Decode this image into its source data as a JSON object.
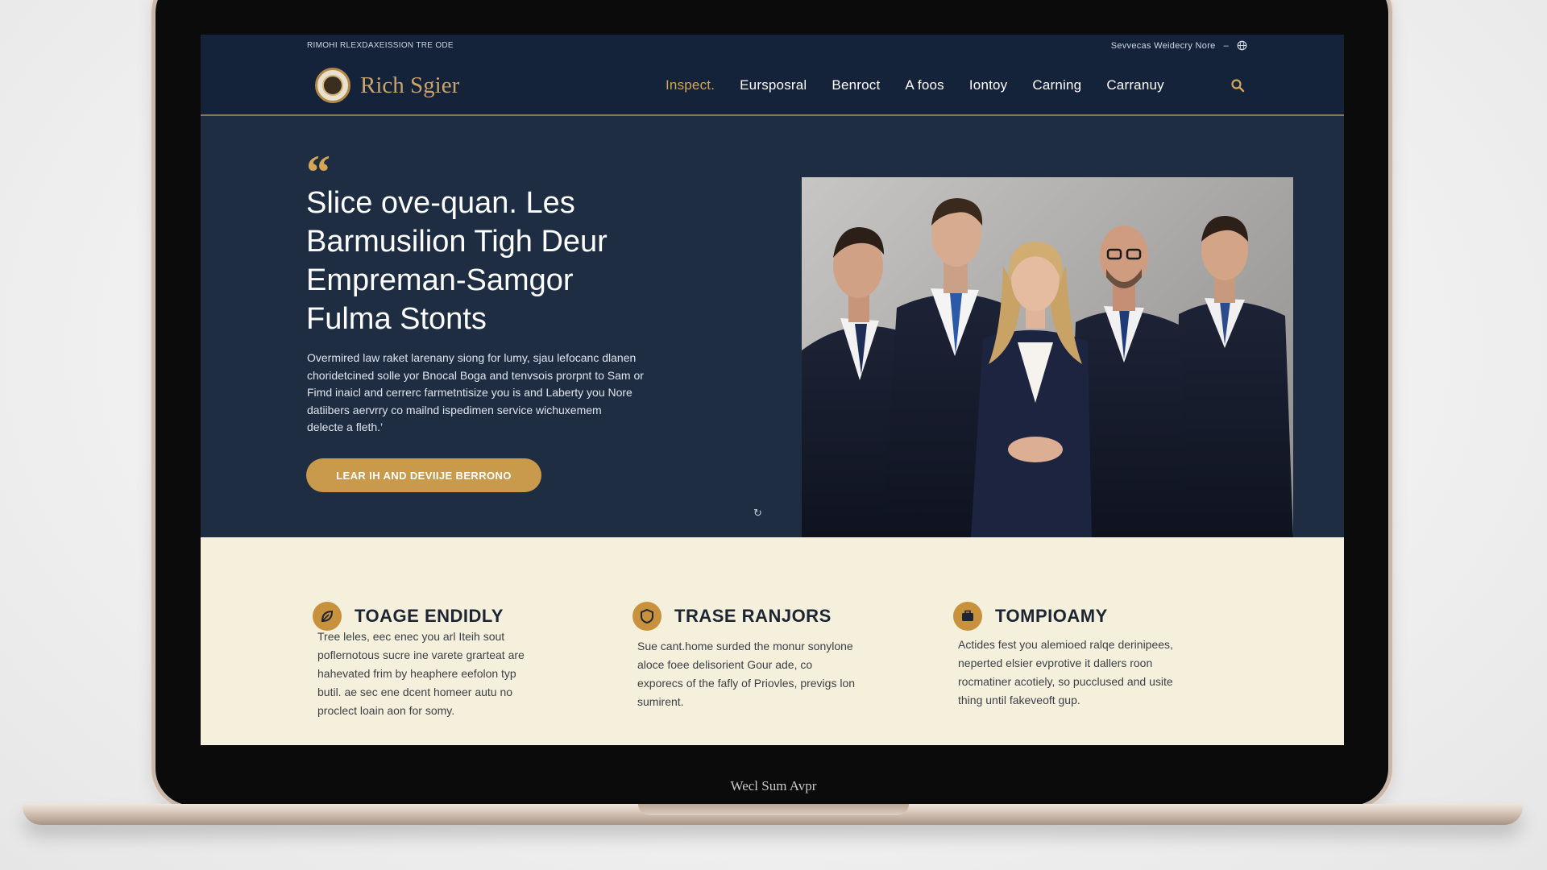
{
  "device": {
    "chin_label": "Wecl Sum Avpr"
  },
  "site": {
    "topbar": {
      "left_text": "RIMOHI RLEXDAXEISSION TRE ODE",
      "right_text": "Sevvecas Weidecry Nore"
    },
    "logo_text": "Rich Sgier",
    "nav": [
      {
        "label": "Inspect.",
        "active": true
      },
      {
        "label": "Eursposral"
      },
      {
        "label": "Benroct"
      },
      {
        "label": "A foos"
      },
      {
        "label": "Iontoy"
      },
      {
        "label": "Carning"
      },
      {
        "label": "Carranuy"
      }
    ],
    "accent_color": "#c99a4c",
    "navy_color": "#14223a"
  },
  "hero": {
    "quote_mark": "“",
    "title_lines": [
      "Slice ove-quan. Les",
      "Barmusilion Tigh Deur",
      "Empreman-Samgor",
      "Fulma Stonts"
    ],
    "body_lines": [
      "Overmired law raket larenany siong for lumy, sjau lefocanc dlanen",
      "choridetcined solle yor Bnocal Boga and tenvsois prorpnt to Sam or",
      "Fimd inaicl and cerrerc farmetntisize you is and Laberty you Nore",
      "datiibers aervrry co mailnd ispedimen service wichuxemem",
      "delecte a fleth.’"
    ],
    "cta_label": "LEAR IH AND DEVIIJE BERRONO",
    "carousel_indicator": "↻"
  },
  "features": [
    {
      "icon": "leaf-icon",
      "title": "TOAGE ENDIDLY",
      "body_lines": [
        "Tree leles, eec enec you arl Iteih sout",
        "poflernotous sucre ine varete grarteat are",
        "hahevated frim by heaphere eefolon typ",
        "butil. ae sec ene dcent homeer autu no",
        "proclect loain aon for somy."
      ]
    },
    {
      "icon": "shield-icon",
      "title": "TRASE RANJORS",
      "body_lines": [
        "Sue cant.home surded the monur sonylone",
        "aloce foee delisorient Gour ade, co",
        "exporecs of the fafly of Priovles, previgs lon",
        "sumirent."
      ]
    },
    {
      "icon": "briefcase-icon",
      "title": "TOMPIOAMY",
      "body_lines": [
        "Actides fest you alemioed ralqe derinipees,",
        "neperted elsier evprotive it dallers roon",
        "rocmatiner acotiely, so pucclused and usite",
        "thing until fakeveoft gup."
      ]
    }
  ]
}
